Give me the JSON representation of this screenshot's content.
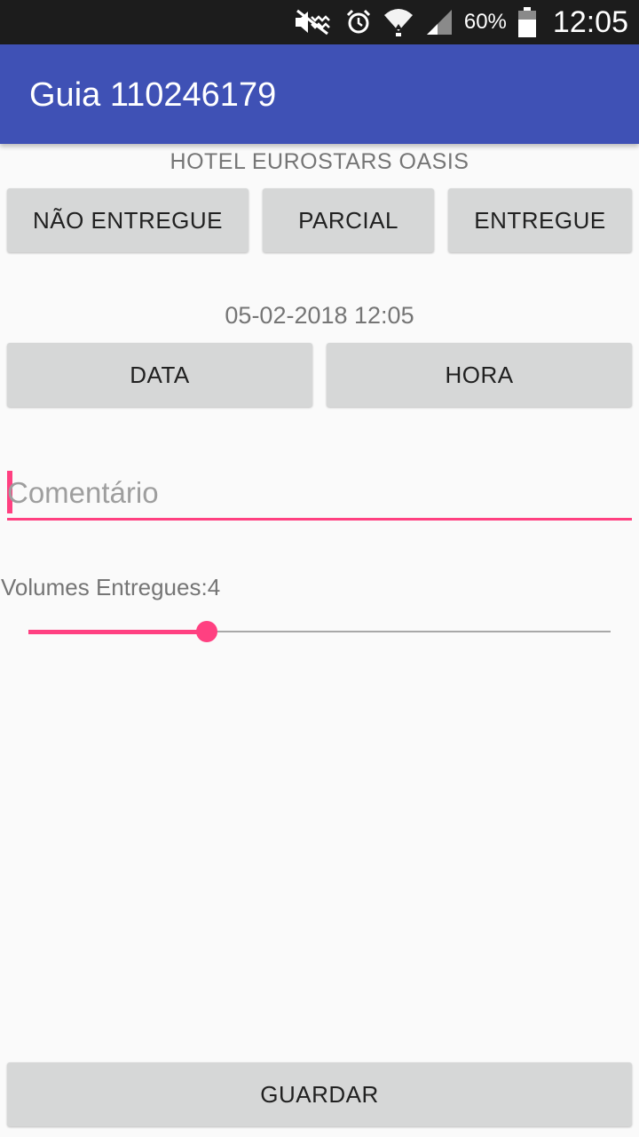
{
  "status_bar": {
    "battery_percent": "60%",
    "time": "12:05",
    "icons": [
      "mute-icon",
      "alarm-icon",
      "wifi-icon",
      "signal-icon",
      "battery-icon"
    ]
  },
  "app_bar": {
    "title": "Guia 110246179"
  },
  "hotel_name": "HOTEL EUROSTARS OASIS",
  "delivery_buttons": {
    "nao_entregue": "NÃO ENTREGUE",
    "parcial": "PARCIAL",
    "entregue": "ENTREGUE"
  },
  "datetime": "05-02-2018 12:05",
  "date_time_buttons": {
    "data": "DATA",
    "hora": "HORA"
  },
  "comment": {
    "value": "",
    "placeholder": "Comentário"
  },
  "volumes": {
    "label": "Volumes Entregues:4",
    "slider_fraction": 0.307
  },
  "save_button": "GUARDAR",
  "colors": {
    "primary": "#3f51b5",
    "accent": "#ff4081",
    "button": "#d6d7d7"
  }
}
